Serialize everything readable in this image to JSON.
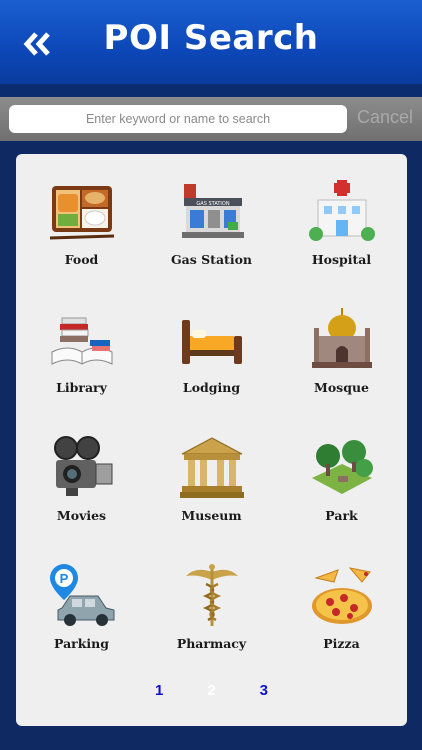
{
  "header": {
    "title": "POI Search",
    "back_icon": "double-chevron-left-icon"
  },
  "search": {
    "placeholder": "Enter keyword or name to search",
    "value": "",
    "cancel_label": "Cancel"
  },
  "categories": [
    {
      "label": "Food",
      "icon": "food-bento-icon"
    },
    {
      "label": "Gas Station",
      "icon": "gas-station-icon"
    },
    {
      "label": "Hospital",
      "icon": "hospital-icon"
    },
    {
      "label": "Library",
      "icon": "books-icon"
    },
    {
      "label": "Lodging",
      "icon": "bed-icon"
    },
    {
      "label": "Mosque",
      "icon": "mosque-icon"
    },
    {
      "label": "Movies",
      "icon": "movie-camera-icon"
    },
    {
      "label": "Museum",
      "icon": "museum-icon"
    },
    {
      "label": "Park",
      "icon": "park-icon"
    },
    {
      "label": "Parking",
      "icon": "parking-car-icon"
    },
    {
      "label": "Pharmacy",
      "icon": "caduceus-icon"
    },
    {
      "label": "Pizza",
      "icon": "pizza-icon"
    }
  ],
  "pagination": {
    "pages": [
      "1",
      "2",
      "3"
    ],
    "current": "2"
  },
  "colors": {
    "header": "#0d47b8",
    "background": "#0f2a63",
    "panel": "#f0eff0",
    "page_link": "#1010d0"
  }
}
